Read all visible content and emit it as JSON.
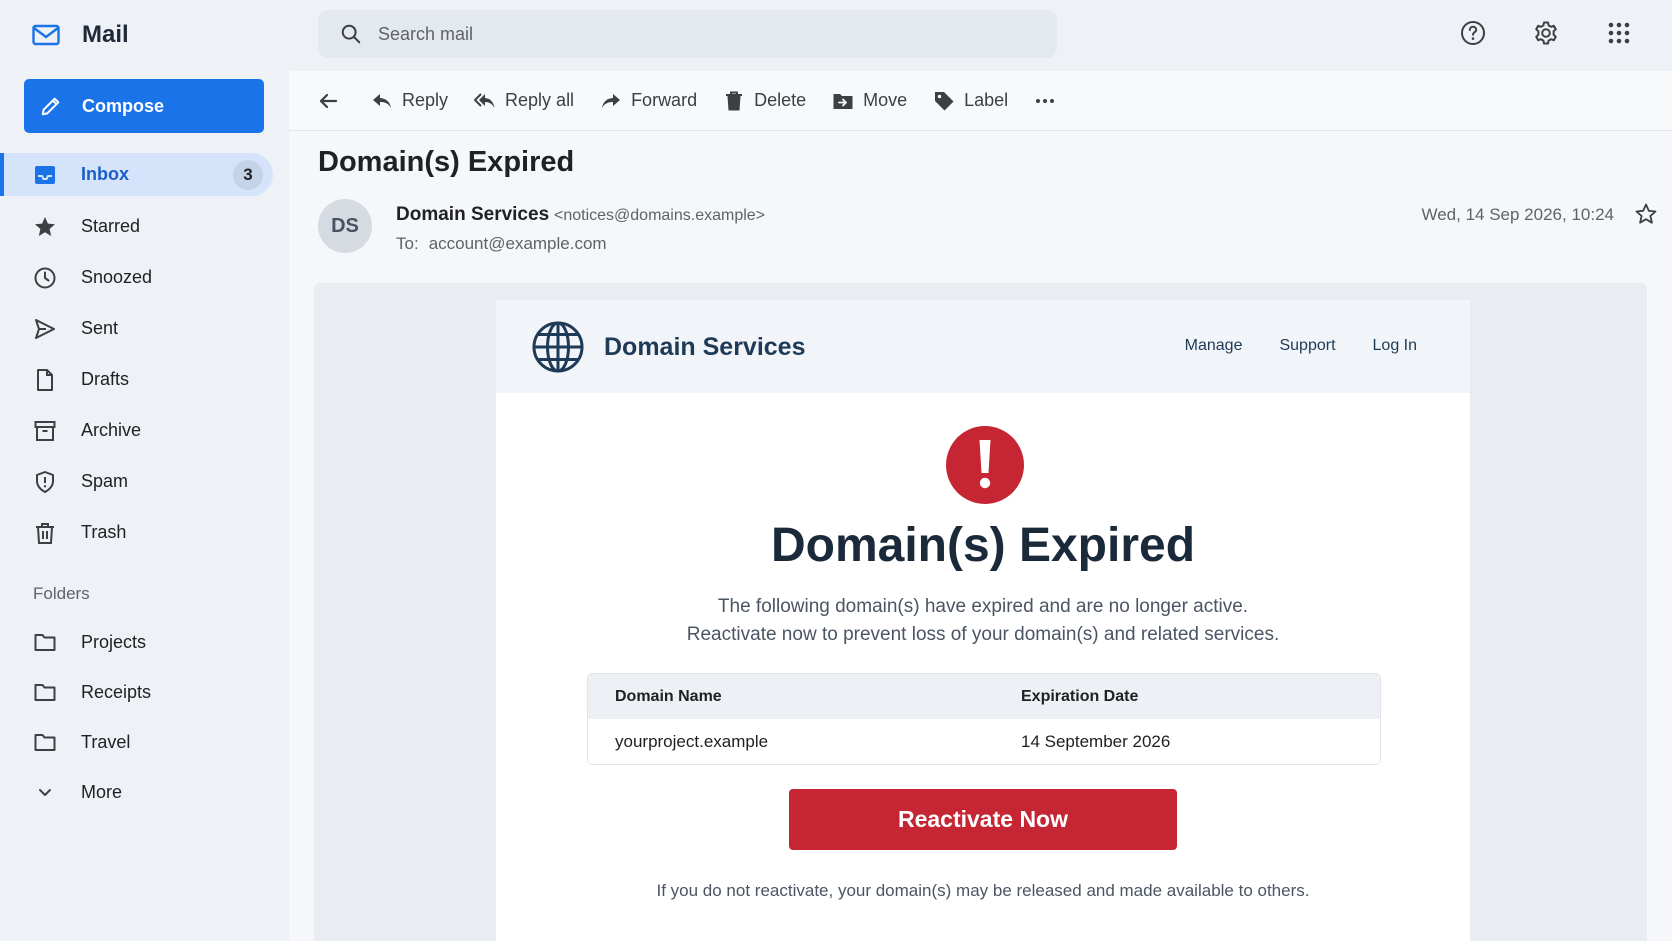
{
  "app": {
    "name": "Mail"
  },
  "compose": {
    "label": "Compose"
  },
  "nav": [
    {
      "key": "inbox",
      "label": "Inbox",
      "count": "3",
      "icon": "inbox-icon"
    },
    {
      "key": "starred",
      "label": "Starred",
      "icon": "star-icon"
    },
    {
      "key": "snoozed",
      "label": "Snoozed",
      "icon": "clock-icon"
    },
    {
      "key": "sent",
      "label": "Sent",
      "icon": "send-icon"
    },
    {
      "key": "drafts",
      "label": "Drafts",
      "icon": "draft-icon"
    },
    {
      "key": "archive",
      "label": "Archive",
      "icon": "archive-icon"
    },
    {
      "key": "spam",
      "label": "Spam",
      "icon": "spam-icon"
    },
    {
      "key": "trash",
      "label": "Trash",
      "icon": "trash-icon"
    }
  ],
  "folders": {
    "heading": "Folders",
    "items": [
      {
        "label": "Projects",
        "icon": "folder-icon"
      },
      {
        "label": "Receipts",
        "icon": "folder-icon"
      },
      {
        "label": "Travel",
        "icon": "folder-icon"
      },
      {
        "label": "More",
        "icon": "chevron-down-icon"
      }
    ]
  },
  "search": {
    "placeholder": "Search mail"
  },
  "toolbar": {
    "reply": "Reply",
    "reply_all": "Reply all",
    "forward": "Forward",
    "delete": "Delete",
    "move": "Move",
    "label": "Label"
  },
  "message": {
    "subject": "Domain(s) Expired",
    "avatar_initials": "DS",
    "sender_name": "Domain Services",
    "sender_email": "<notices@domains.example>",
    "to_label": "To:",
    "to_value": "account@example.com",
    "date": "Wed, 14 Sep 2026, 10:24"
  },
  "email": {
    "brand": "Domain Services",
    "links": [
      "Manage",
      "Support",
      "Log In"
    ],
    "title": "Domain(s) Expired",
    "text_line1": "The following domain(s) have expired and are no longer active.",
    "text_line2": "Reactivate now to prevent loss of your domain(s) and related services.",
    "table": {
      "headers": [
        "Domain Name",
        "Expiration Date"
      ],
      "rows": [
        [
          "yourproject.example",
          "14 September 2026"
        ]
      ]
    },
    "cta": "Reactivate Now",
    "footnote": "If you do not reactivate, your domain(s) may be released and made available to others."
  },
  "colors": {
    "accent": "#1a73e8",
    "cta": "#c62533",
    "alert": "#c62533",
    "brand_text": "#1f3a56"
  }
}
